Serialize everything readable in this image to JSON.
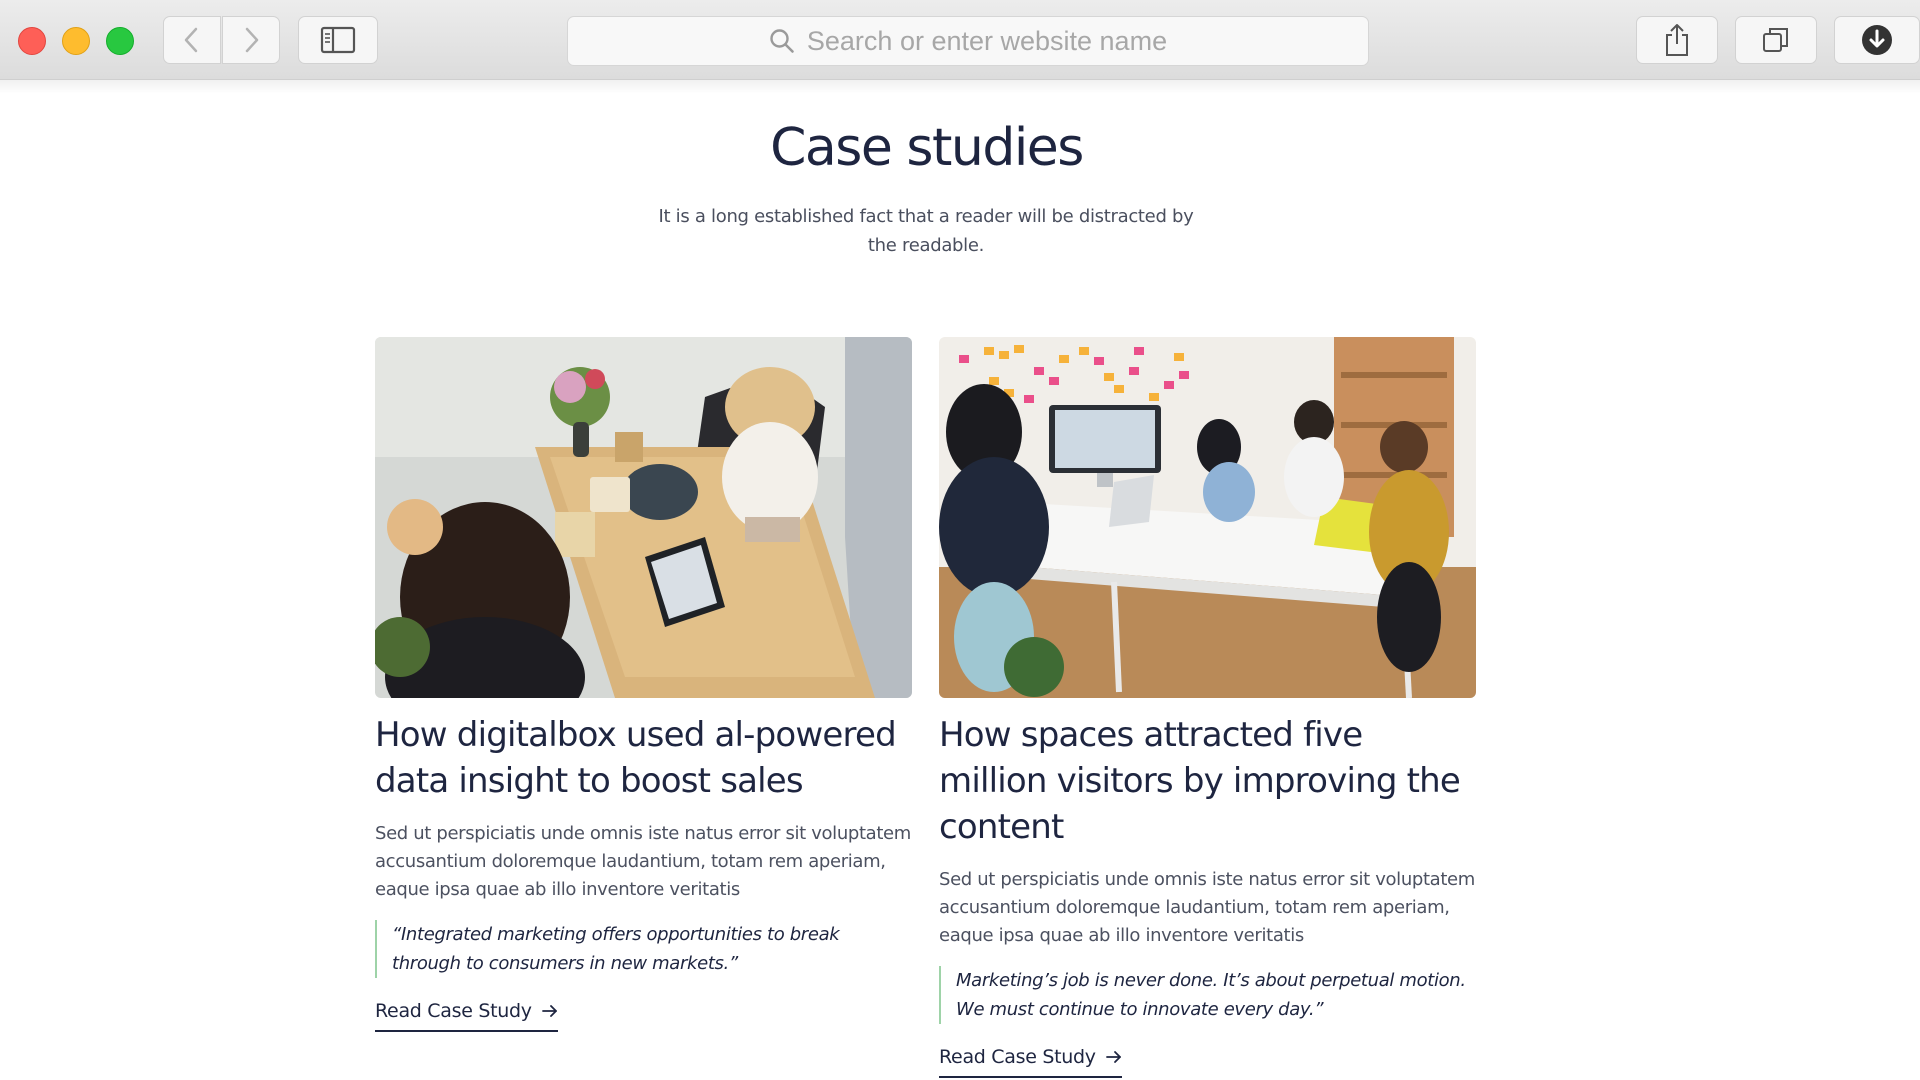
{
  "browser": {
    "address_placeholder": "Search or enter website name",
    "icons": [
      "chevron-left-icon",
      "chevron-right-icon",
      "sidebar-icon",
      "search-icon",
      "share-icon",
      "tabs-icon",
      "download-icon"
    ]
  },
  "page": {
    "title": "Case studies",
    "subtitle": "It is a long established fact that a reader will be distracted by the readable."
  },
  "cards": [
    {
      "image_description": "photo-two-women-at-desk-with-tablet",
      "title": "How digitalbox used al-powered data insight to boost sales",
      "description": "Sed ut perspiciatis unde omnis iste natus error sit voluptatem accusantium doloremque laudantium, totam rem aperiam, eaque ipsa quae ab illo inventore veritatis",
      "quote": "“Integrated marketing offers opportunities to break through to consumers in new markets.”",
      "link_label": "Read Case Study"
    },
    {
      "image_description": "photo-team-meeting-around-table",
      "title": "How spaces attracted five million visitors by improving the content",
      "description": "Sed ut perspiciatis unde omnis iste natus error sit voluptatem accusantium doloremque laudantium, totam rem aperiam, eaque ipsa quae ab illo inventore veritatis",
      "quote": "Marketing’s job is never done. It’s about perpetual motion. We must continue to innovate every day.”",
      "link_label": "Read Case Study"
    }
  ],
  "colors": {
    "heading": "#1e2540",
    "body_text": "#4c5160",
    "quote_border": "#9ed3a8",
    "toolbar": "#e4e4e4"
  }
}
